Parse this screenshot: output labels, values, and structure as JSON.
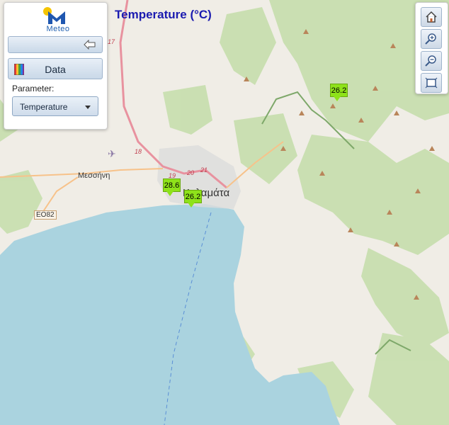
{
  "app": {
    "logo_text": "Meteo"
  },
  "sidebar": {
    "data_button_label": "Data",
    "parameter_label": "Parameter:",
    "parameter_selected": "Temperature"
  },
  "map": {
    "title": "Temperature (°C)",
    "stations": [
      {
        "value": "26.2"
      },
      {
        "value": "28.6"
      },
      {
        "value": "26.2"
      }
    ],
    "places": {
      "city": "Καλαμάτα",
      "village": "Μεσσήνη",
      "road_ref": "EO82",
      "junctions": [
        "17",
        "18",
        "19",
        "20",
        "21"
      ]
    }
  },
  "toolbar": {
    "icons": [
      "home-icon",
      "zoom-in-icon",
      "zoom-out-icon",
      "full-extent-icon"
    ]
  },
  "colors": {
    "sea": "#aad3df",
    "land": "#f0ede6",
    "forest": "#c8dfb0",
    "marker": "#8ee21a",
    "title": "#1b1bb0",
    "motorway": "#e8929f"
  }
}
